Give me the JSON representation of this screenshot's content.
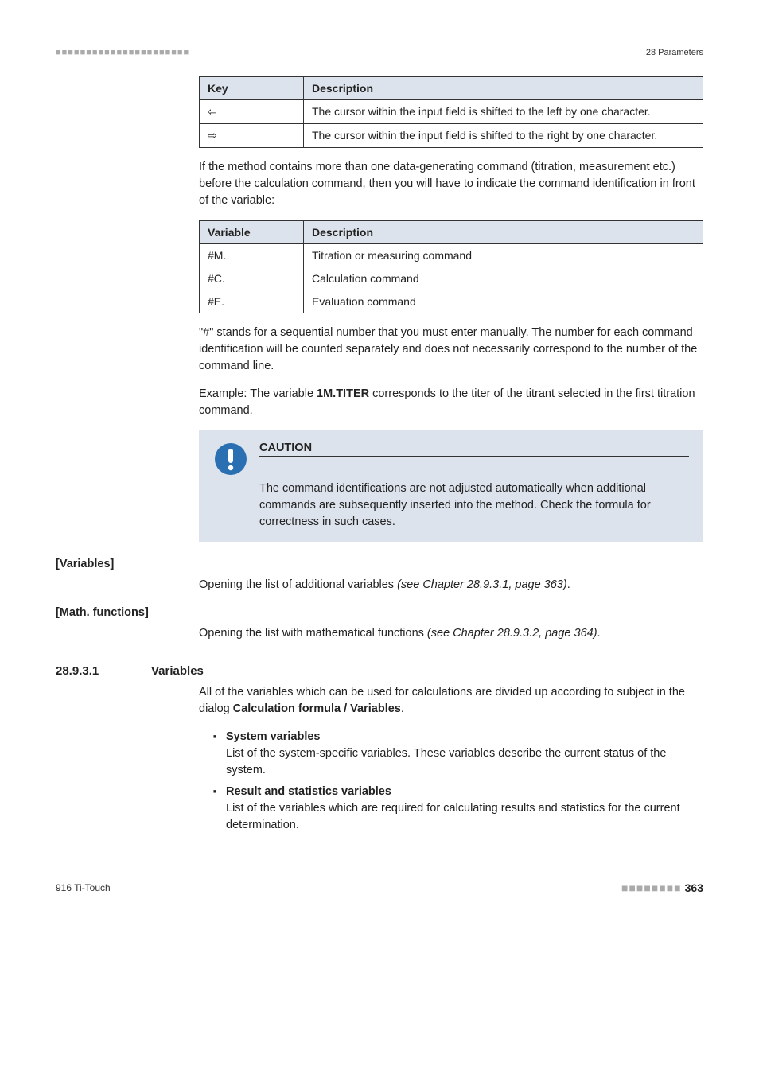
{
  "header": {
    "squares": "■■■■■■■■■■■■■■■■■■■■■■",
    "right": "28 Parameters"
  },
  "table1": {
    "head_key": "Key",
    "head_desc": "Description",
    "rows": [
      {
        "key": "⇦",
        "desc": "The cursor within the input field is shifted to the left by one character."
      },
      {
        "key": "⇨",
        "desc": "The cursor within the input field is shifted to the right by one character."
      }
    ]
  },
  "para1": "If the method contains more than one data-generating command (titration, measurement etc.) before the calculation command, then you will have to indicate the command identification in front of the variable:",
  "table2": {
    "head_var": "Variable",
    "head_desc": "Description",
    "rows": [
      {
        "var": "#M.",
        "desc": "Titration or measuring command"
      },
      {
        "var": "#C.",
        "desc": "Calculation command"
      },
      {
        "var": "#E.",
        "desc": "Evaluation command"
      }
    ]
  },
  "para2": "\"#\" stands for a sequential number that you must enter manually. The number for each command identification will be counted separately and does not necessarily correspond to the number of the command line.",
  "para3_pre": "Example: The variable ",
  "para3_bold": "1M.TITER",
  "para3_post": " corresponds to the titer of the titrant selected in the first titration command.",
  "caution": {
    "title": "CAUTION",
    "text": "The command identifications are not adjusted automatically when additional commands are subsequently inserted into the method. Check the formula for correctness in such cases."
  },
  "variables": {
    "label": "[Variables]",
    "text_pre": "Opening the list of additional variables ",
    "text_italic": "(see Chapter 28.9.3.1, page 363)",
    "text_post": "."
  },
  "mathfunc": {
    "label": "[Math. functions]",
    "text_pre": "Opening the list with mathematical functions ",
    "text_italic": "(see Chapter 28.9.3.2, page 364)",
    "text_post": "."
  },
  "section": {
    "num": "28.9.3.1",
    "title": "Variables",
    "intro_pre": "All of the variables which can be used for calculations are divided up according to subject in the dialog ",
    "intro_bold": "Calculation formula / Variables",
    "intro_post": ".",
    "bullets": [
      {
        "title": "System variables",
        "body": "List of the system-specific variables. These variables describe the current status of the system."
      },
      {
        "title": "Result and statistics variables",
        "body": "List of the variables which are required for calculating results and statistics for the current determination."
      }
    ]
  },
  "footer": {
    "left": "916 Ti-Touch",
    "squares": "■■■■■■■■",
    "page": "363"
  }
}
